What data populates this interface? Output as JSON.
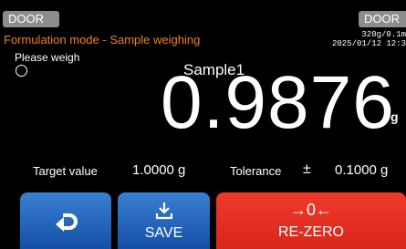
{
  "header": {
    "door_left": "DOOR",
    "door_right": "DOOR",
    "mode_text": "Formulation mode  - Sample weighing",
    "capacity": "320g/0.1m",
    "datetime": "2025/01/12  12:3"
  },
  "main": {
    "prompt": "Please weigh",
    "sample_name": "Sample1",
    "weight": "0.9876",
    "unit": "g"
  },
  "target": {
    "label": "Target value",
    "value": "1.0000 g"
  },
  "tolerance": {
    "label": "Tolerance",
    "symbol": "±",
    "value": "0.1000 g"
  },
  "buttons": {
    "save_label": "SAVE",
    "rezero_symbol": "→0←",
    "rezero_label": "RE-ZERO"
  },
  "colors": {
    "accent_orange": "#f0821e",
    "button_blue": "#1f63bf",
    "button_red": "#e8301f"
  },
  "icons": {
    "back": "return-arrow-icon",
    "save": "download-tray-icon"
  }
}
